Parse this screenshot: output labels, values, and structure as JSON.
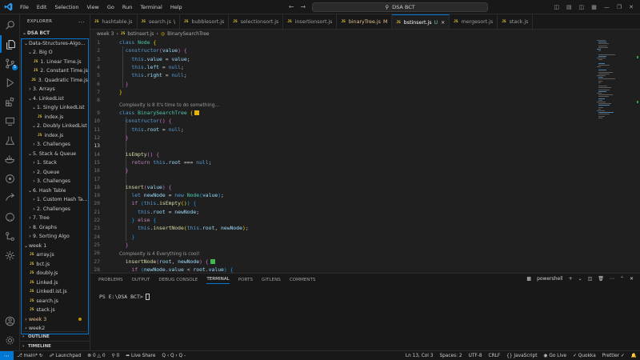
{
  "titlebar": {
    "menu": [
      "File",
      "Edit",
      "Selection",
      "View",
      "Go",
      "Run",
      "Terminal",
      "Help"
    ],
    "search": "DSA BCT"
  },
  "activity": {
    "source_control_badge": "5"
  },
  "sidebar": {
    "title": "EXPLORER",
    "root": "DSA BCT",
    "items": [
      {
        "label": "Data-Structures-Algo...",
        "depth": 1,
        "chev": "v"
      },
      {
        "label": "2. Big O",
        "depth": 2,
        "chev": "v"
      },
      {
        "label": "1. Linear Time.js",
        "depth": 3,
        "js": true
      },
      {
        "label": "2. Constant Time.js",
        "depth": 3,
        "js": true
      },
      {
        "label": "3. Quadratic Time.js",
        "depth": 3,
        "js": true
      },
      {
        "label": "3. Arrays",
        "depth": 2,
        "chev": ">"
      },
      {
        "label": "4. LinkedList",
        "depth": 2,
        "chev": "v"
      },
      {
        "label": "1. Singly LinkedList",
        "depth": 3,
        "chev": "v"
      },
      {
        "label": "index.js",
        "depth": 4,
        "js": true
      },
      {
        "label": "2. Doubly LinkedList",
        "depth": 3,
        "chev": "v"
      },
      {
        "label": "index.js",
        "depth": 4,
        "js": true
      },
      {
        "label": "3. Challenges",
        "depth": 3,
        "chev": ">"
      },
      {
        "label": "5. Stack & Queue",
        "depth": 2,
        "chev": "v"
      },
      {
        "label": "1. Stack",
        "depth": 3,
        "chev": ">"
      },
      {
        "label": "2. Queue",
        "depth": 3,
        "chev": ">"
      },
      {
        "label": "3. Challenges",
        "depth": 3,
        "chev": ">"
      },
      {
        "label": "6. Hash Table",
        "depth": 2,
        "chev": "v"
      },
      {
        "label": "1. Custom Hash Ta...",
        "depth": 3,
        "chev": ">"
      },
      {
        "label": "2. Challenges",
        "depth": 3,
        "chev": ">"
      },
      {
        "label": "7. Tree",
        "depth": 2,
        "chev": ">"
      },
      {
        "label": "8. Graphs",
        "depth": 2,
        "chev": ">"
      },
      {
        "label": "9. Sorting Algo",
        "depth": 2,
        "chev": ">"
      },
      {
        "label": "week 1",
        "depth": 1,
        "chev": "v"
      },
      {
        "label": "array.js",
        "depth": 2,
        "js": true
      },
      {
        "label": "bct.js",
        "depth": 2,
        "js": true
      },
      {
        "label": "doubly.js",
        "depth": 2,
        "js": true
      },
      {
        "label": "Linked.js",
        "depth": 2,
        "js": true
      },
      {
        "label": "Linkedl.ist.js",
        "depth": 2,
        "js": true
      },
      {
        "label": "search.js",
        "depth": 2,
        "js": true
      },
      {
        "label": "stack.js",
        "depth": 2,
        "js": true
      },
      {
        "label": "week 3",
        "depth": 1,
        "chev": ">",
        "modified": true
      },
      {
        "label": "week2",
        "depth": 1,
        "chev": ">"
      }
    ],
    "outline": "OUTLINE",
    "timeline": "TIMELINE"
  },
  "tabs": [
    {
      "label": "hashtable.js"
    },
    {
      "label": "search.js",
      "suffix": "\\"
    },
    {
      "label": "bubblesort.js"
    },
    {
      "label": "selectionsort.js"
    },
    {
      "label": "insertionsort.js"
    },
    {
      "label": "binaryTree.js",
      "suffix": "M",
      "modified": true
    },
    {
      "label": "bstinsert.js",
      "suffix": "U",
      "active": true
    },
    {
      "label": "mergesort.js"
    },
    {
      "label": "stack.js"
    }
  ],
  "breadcrumb": [
    "week 3",
    "bstinsert.js",
    "BinarySearchTree"
  ],
  "codelens": {
    "first": "Complexity is 8 It's time to do something...",
    "second": "Complexity is 4 Everything is cool!"
  },
  "panel": {
    "tabs": [
      "PROBLEMS",
      "OUTPUT",
      "DEBUG CONSOLE",
      "TERMINAL",
      "PORTS",
      "GITLENS",
      "COMMENTS"
    ],
    "active_tab": "TERMINAL",
    "shell": "powershell",
    "prompt": "PS E:\\DSA BCT>"
  },
  "status": {
    "branch": "main*",
    "launchpad": "Launchpad",
    "errors": "0",
    "warnings": "0",
    "live_share": "Live Share",
    "cursor": "Ln 13, Col 3",
    "spaces": "Spaces: 2",
    "encoding": "UTF-8",
    "eol": "CRLF",
    "language": "JavaScript",
    "go_live": "Go Live",
    "quokka": "Quokka",
    "prettier": "Prettier"
  },
  "colors": {
    "accent": "#0078d4",
    "js_icon": "#e8c83c",
    "modified": "#e2c08d",
    "lens_square_1": "#e8b400",
    "lens_square_2": "#3fb950"
  }
}
